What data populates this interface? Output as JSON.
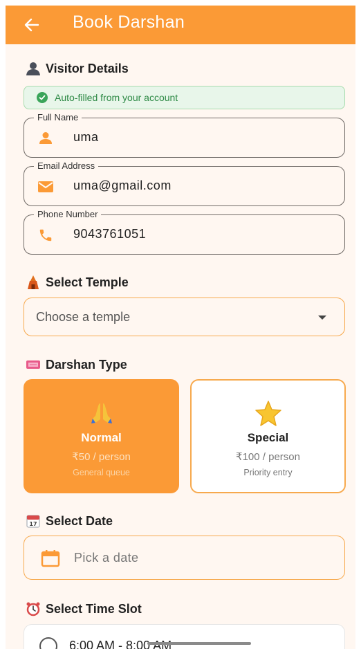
{
  "appbar": {
    "title": "Book Darshan",
    "back_icon": "arrow-left-icon",
    "color": "#fb9a36"
  },
  "visitor": {
    "title": "Visitor Details",
    "autofill_text": "Auto-filled from your account",
    "fields": [
      {
        "legend": "Full Name",
        "value": "uma",
        "icon": "person-icon"
      },
      {
        "legend": "Email Address",
        "value": "uma@gmail.com",
        "icon": "mail-icon"
      },
      {
        "legend": "Phone Number",
        "value": "9043761051",
        "icon": "phone-icon"
      }
    ]
  },
  "temple": {
    "title": "Select Temple",
    "placeholder": "Choose a temple"
  },
  "darshan": {
    "title": "Darshan Type",
    "options": [
      {
        "name": "Normal",
        "price": "₹50 / person",
        "sub": "General queue",
        "selected": true
      },
      {
        "name": "Special",
        "price": "₹100 / person",
        "sub": "Priority entry",
        "selected": false
      }
    ]
  },
  "date": {
    "title": "Select Date",
    "placeholder": "Pick a date"
  },
  "timeslot": {
    "title": "Select Time Slot",
    "slots": [
      {
        "label": "6:00 AM - 8:00 AM",
        "selected": false
      }
    ]
  }
}
